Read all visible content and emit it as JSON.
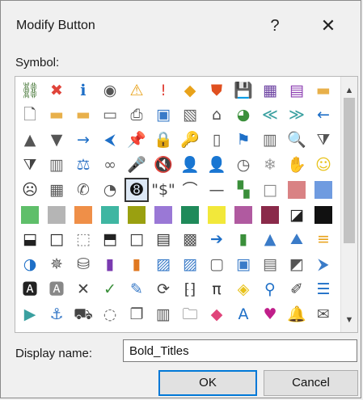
{
  "dialog": {
    "title": "Modify Button",
    "help_label": "?",
    "close_label": "✕",
    "symbol_label": "Symbol:",
    "display_name_label": "Display name:",
    "display_name_value": "Bold_Titles",
    "ok_label": "OK",
    "cancel_label": "Cancel",
    "scroll_up": "▲",
    "scroll_down": "▼"
  },
  "symbols": [
    [
      {
        "g": "⛓",
        "c": "#3a6e2a",
        "n": "network-icon"
      },
      {
        "g": "✖",
        "c": "#e0443a",
        "n": "error-icon"
      },
      {
        "g": "ℹ",
        "c": "#1e6fc7",
        "n": "info-icon"
      },
      {
        "g": "◉",
        "c": "#555555",
        "n": "record-icon"
      },
      {
        "g": "⚠",
        "c": "#e8a21a",
        "n": "warning-icon"
      },
      {
        "g": "!",
        "c": "#e0443a",
        "n": "exclamation-icon"
      },
      {
        "g": "◆",
        "c": "#e8a21a",
        "n": "diamond-alert-icon"
      },
      {
        "g": "⛊",
        "c": "#e05020",
        "n": "shield-icon"
      },
      {
        "g": "💾",
        "c": "#3b5fc0",
        "n": "save-icon"
      },
      {
        "g": "▦",
        "c": "#6a3fa0",
        "n": "save-all-icon"
      },
      {
        "g": "▤",
        "c": "#8a3ab0",
        "n": "save-as-icon"
      },
      {
        "g": "▬",
        "c": "#e8b04a",
        "n": "folder-icon"
      }
    ],
    [
      {
        "g": "🗋",
        "c": "#555555",
        "n": "new-page-icon"
      },
      {
        "g": "▬",
        "c": "#e8b04a",
        "n": "open-folder-icon"
      },
      {
        "g": "▬",
        "c": "#e8b04a",
        "n": "folder-up-icon"
      },
      {
        "g": "▭",
        "c": "#666666",
        "n": "print-preview-icon"
      },
      {
        "g": "⎙",
        "c": "#555555",
        "n": "print-icon"
      },
      {
        "g": "▣",
        "c": "#3a7bc8",
        "n": "picture-icon"
      },
      {
        "g": "▧",
        "c": "#666666",
        "n": "document-image-icon"
      },
      {
        "g": "⌂",
        "c": "#555555",
        "n": "home-icon"
      },
      {
        "g": "◕",
        "c": "#3a8f3a",
        "n": "pie-globe-icon"
      },
      {
        "g": "≪",
        "c": "#3aa0a0",
        "n": "double-left-icon"
      },
      {
        "g": "≫",
        "c": "#3aa0a0",
        "n": "double-right-icon"
      },
      {
        "g": "←",
        "c": "#1e6fc7",
        "n": "arrow-left-icon"
      }
    ],
    [
      {
        "g": "▲",
        "c": "#555555",
        "n": "triangle-up-icon"
      },
      {
        "g": "▼",
        "c": "#555555",
        "n": "triangle-down-icon"
      },
      {
        "g": "→",
        "c": "#1e6fc7",
        "n": "arrow-right-icon"
      },
      {
        "g": "⮜",
        "c": "#1e6fc7",
        "n": "circle-left-icon"
      },
      {
        "g": "📌",
        "c": "#444444",
        "n": "pin-icon"
      },
      {
        "g": "🔒",
        "c": "#e8a21a",
        "n": "lock-icon"
      },
      {
        "g": "🔑",
        "c": "#555555",
        "n": "key-icon"
      },
      {
        "g": "▯",
        "c": "#555555",
        "n": "door-icon"
      },
      {
        "g": "⚑",
        "c": "#1e6fc7",
        "n": "flag-icon"
      },
      {
        "g": "▥",
        "c": "#666666",
        "n": "calendar-icon"
      },
      {
        "g": "🔍",
        "c": "#555555",
        "n": "search-icon"
      },
      {
        "g": "⧩",
        "c": "#555555",
        "n": "filter-icon"
      }
    ],
    [
      {
        "g": "⧩",
        "c": "#444444",
        "n": "funnel-icon"
      },
      {
        "g": "▥",
        "c": "#666666",
        "n": "book-icon"
      },
      {
        "g": "⚖",
        "c": "#3a7bc8",
        "n": "scales-icon"
      },
      {
        "g": "∞",
        "c": "#666666",
        "n": "glasses-icon"
      },
      {
        "g": "🎤",
        "c": "#1e6fc7",
        "n": "microphone-icon"
      },
      {
        "g": "🔇",
        "c": "#444444",
        "n": "mute-icon"
      },
      {
        "g": "👤",
        "c": "#b05a30",
        "n": "person-icon"
      },
      {
        "g": "👤",
        "c": "#555555",
        "n": "user-icon"
      },
      {
        "g": "◷",
        "c": "#555555",
        "n": "clock-icon"
      },
      {
        "g": "❄",
        "c": "#999999",
        "n": "snowflake-icon"
      },
      {
        "g": "✋",
        "c": "#555555",
        "n": "hand-icon"
      },
      {
        "g": "☺",
        "c": "#e8c21a",
        "n": "smiley-icon"
      }
    ],
    [
      {
        "g": "☹",
        "c": "#333333",
        "n": "sad-face-icon"
      },
      {
        "g": "▦",
        "c": "#555555",
        "n": "calculator-icon"
      },
      {
        "g": "✆",
        "c": "#555555",
        "n": "phone-icon"
      },
      {
        "g": "◔",
        "c": "#555555",
        "n": "piggy-bank-icon"
      },
      {
        "g": "➑",
        "c": "#111111",
        "n": "eight-ball-icon",
        "sel": true
      },
      {
        "g": "\"$\"",
        "c": "#444444",
        "n": "dollar-quote-icon"
      },
      {
        "g": "⌒",
        "c": "#444444",
        "n": "wifi-arc-icon"
      },
      {
        "g": "—",
        "c": "#444444",
        "n": "dash-icon"
      },
      {
        "g": "▚",
        "c": "#3a8f3a",
        "n": "color-grid-icon"
      },
      {
        "g": "□",
        "c": "#888888",
        "n": "empty-square-icon"
      },
      {
        "s": "#d98284",
        "n": "swatch-rose"
      },
      {
        "s": "#6f9be0",
        "n": "swatch-blue"
      }
    ],
    [
      {
        "s": "#5fbf6a",
        "n": "swatch-green"
      },
      {
        "s": "#b5b5b5",
        "n": "swatch-gray"
      },
      {
        "s": "#ef8f48",
        "n": "swatch-orange"
      },
      {
        "s": "#3fb6a2",
        "n": "swatch-teal"
      },
      {
        "s": "#9aa010",
        "n": "swatch-olive"
      },
      {
        "s": "#9a78d6",
        "n": "swatch-lavender"
      },
      {
        "s": "#1f8a5a",
        "n": "swatch-dark-green"
      },
      {
        "s": "#f2e83a",
        "n": "swatch-yellow"
      },
      {
        "s": "#b05aa0",
        "n": "swatch-purple"
      },
      {
        "s": "#8a2a4a",
        "n": "swatch-maroon"
      },
      {
        "g": "◪",
        "c": "#222222",
        "n": "half-square-icon"
      },
      {
        "s": "#111111",
        "n": "swatch-black"
      }
    ],
    [
      {
        "g": "⬓",
        "c": "#222222",
        "n": "bottom-half-square-icon"
      },
      {
        "g": "□",
        "c": "#222222",
        "n": "outline-square-icon"
      },
      {
        "g": "⬚",
        "c": "#888888",
        "n": "dotted-square-icon"
      },
      {
        "g": "⬒",
        "c": "#222222",
        "n": "top-half-square-icon"
      },
      {
        "g": "□",
        "c": "#333333",
        "n": "square-icon"
      },
      {
        "g": "▤",
        "c": "#333333",
        "n": "lined-square-icon"
      },
      {
        "g": "▩",
        "c": "#555555",
        "n": "checker-icon"
      },
      {
        "g": "➔",
        "c": "#1e6fc7",
        "n": "circle-arrow-icon"
      },
      {
        "g": "▮",
        "c": "#3a8f3a",
        "n": "bar-chart-icon"
      },
      {
        "g": "▲",
        "c": "#3a7bc8",
        "n": "pyramid-icon"
      },
      {
        "g": "⛰",
        "c": "#3a7bc8",
        "n": "mountain-icon"
      },
      {
        "g": "≡",
        "c": "#e8a21a",
        "n": "list-bars-icon"
      }
    ],
    [
      {
        "g": "◑",
        "c": "#1e6fc7",
        "n": "pie-chart-icon"
      },
      {
        "g": "✵",
        "c": "#555555",
        "n": "radar-icon"
      },
      {
        "g": "⛁",
        "c": "#555555",
        "n": "database-icon"
      },
      {
        "g": "▮",
        "c": "#7a3ab0",
        "n": "purple-book-icon"
      },
      {
        "g": "▮",
        "c": "#e07820",
        "n": "orange-book-icon"
      },
      {
        "g": "▨",
        "c": "#3a7bc8",
        "n": "chart-card-icon"
      },
      {
        "g": "▨",
        "c": "#3a7bc8",
        "n": "image-chart-icon"
      },
      {
        "g": "▢",
        "c": "#666666",
        "n": "frame-icon"
      },
      {
        "g": "▣",
        "c": "#3a7bc8",
        "n": "contact-card-icon"
      },
      {
        "g": "▤",
        "c": "#666666",
        "n": "table-icon"
      },
      {
        "g": "◩",
        "c": "#555555",
        "n": "edit-image-icon"
      },
      {
        "g": "⮞",
        "c": "#3a7bc8",
        "n": "play-chart-icon"
      }
    ],
    [
      {
        "g": "🅰",
        "c": "#222222",
        "n": "text-box-icon"
      },
      {
        "g": "🅰",
        "c": "#888888",
        "n": "text-shaded-icon"
      },
      {
        "g": "✕",
        "c": "#444444",
        "n": "x-mark-icon"
      },
      {
        "g": "✓",
        "c": "#3a8f3a",
        "n": "check-icon"
      },
      {
        "g": "✎",
        "c": "#3a7bc8",
        "n": "edit-chart-icon"
      },
      {
        "g": "⟳",
        "c": "#444444",
        "n": "refresh-icon"
      },
      {
        "g": "⁅⁆",
        "c": "#444444",
        "n": "binary-icon"
      },
      {
        "g": "π",
        "c": "#333333",
        "n": "pi-icon"
      },
      {
        "g": "◈",
        "c": "#e8c21a",
        "n": "paint-bucket-icon"
      },
      {
        "g": "⚲",
        "c": "#1e6fc7",
        "n": "magnifier-icon"
      },
      {
        "g": "✐",
        "c": "#444444",
        "n": "wand-icon"
      },
      {
        "g": "☰",
        "c": "#1e6fc7",
        "n": "bullet-list-icon"
      }
    ],
    [
      {
        "g": "▶",
        "c": "#3aa0a0",
        "n": "play-icon"
      },
      {
        "g": "⚓",
        "c": "#3a7bc8",
        "n": "anchor-icon"
      },
      {
        "g": "⛟",
        "c": "#444444",
        "n": "toolbox-icon"
      },
      {
        "g": "◌",
        "c": "#666666",
        "n": "new-shape-icon"
      },
      {
        "g": "❐",
        "c": "#555555",
        "n": "copy-icon"
      },
      {
        "g": "▥",
        "c": "#555555",
        "n": "form-icon"
      },
      {
        "g": "🗀",
        "c": "#555555",
        "n": "folder-outline-icon"
      },
      {
        "g": "◆",
        "c": "#e0447a",
        "n": "eraser-icon"
      },
      {
        "g": "A",
        "c": "#1e6fc7",
        "n": "font-color-icon"
      },
      {
        "g": "♥",
        "c": "#c01e8a",
        "n": "heart-icon"
      },
      {
        "g": "🔔",
        "c": "#e8a21a",
        "n": "bell-icon"
      },
      {
        "g": "✉",
        "c": "#555555",
        "n": "envelope-icon"
      }
    ]
  ]
}
